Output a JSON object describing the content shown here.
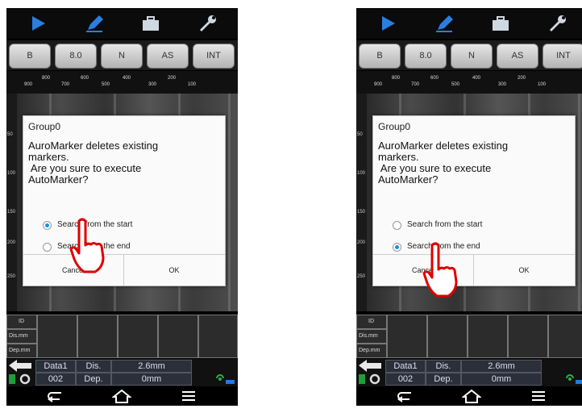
{
  "screens": [
    {
      "toolbar": {
        "icons": [
          "play-icon",
          "pencil-icon",
          "briefcase-icon",
          "wrench-icon"
        ]
      },
      "modes": [
        "B",
        "8.0",
        "N",
        "AS",
        "INT"
      ],
      "ruler_ticks": [
        "900",
        "800",
        "700",
        "600",
        "500",
        "400",
        "300",
        "200",
        "100"
      ],
      "depth_ticks": [
        "50",
        "100",
        "150",
        "200",
        "250"
      ],
      "dialog": {
        "title": "Group0",
        "message_lines": [
          "AuroMarker deletes existing",
          "markers.",
          " Are you sure to execute",
          "AutoMarker?"
        ],
        "options": [
          {
            "label": "Search from the start",
            "selected": true
          },
          {
            "label": "Search from the end",
            "selected": false
          }
        ],
        "cancel_label": "Cancel",
        "ok_label": "OK"
      },
      "grid_rows": [
        "ID",
        "Dis.mm",
        "Dep.mm"
      ],
      "status": {
        "data": "Data1",
        "number": "002",
        "dis_label": "Dis.",
        "dep_label": "Dep.",
        "dis_value": "2.6mm",
        "dep_value": "0mm"
      },
      "pointer_target": "start-option"
    },
    {
      "toolbar": {
        "icons": [
          "play-icon",
          "pencil-icon",
          "briefcase-icon",
          "wrench-icon"
        ]
      },
      "modes": [
        "B",
        "8.0",
        "N",
        "AS",
        "INT"
      ],
      "ruler_ticks": [
        "900",
        "800",
        "700",
        "600",
        "500",
        "400",
        "300",
        "200",
        "100"
      ],
      "depth_ticks": [
        "50",
        "100",
        "150",
        "200",
        "250"
      ],
      "dialog": {
        "title": "Group0",
        "message_lines": [
          "AuroMarker deletes existing",
          "markers.",
          " Are you sure to execute",
          "AutoMarker?"
        ],
        "options": [
          {
            "label": "Search from the start",
            "selected": false
          },
          {
            "label": "Search from the end",
            "selected": true
          }
        ],
        "cancel_label": "Cancel",
        "ok_label": "OK"
      },
      "grid_rows": [
        "ID",
        "Dis.mm",
        "Dep.mm"
      ],
      "status": {
        "data": "Data1",
        "number": "002",
        "dis_label": "Dis.",
        "dep_label": "Dep.",
        "dis_value": "2.6mm",
        "dep_value": "0mm"
      },
      "pointer_target": "cancel-button"
    }
  ],
  "colors": {
    "accent": "#1a8fe0",
    "hand": "#e00000",
    "toolbar_icon": "#1e6fd0"
  }
}
